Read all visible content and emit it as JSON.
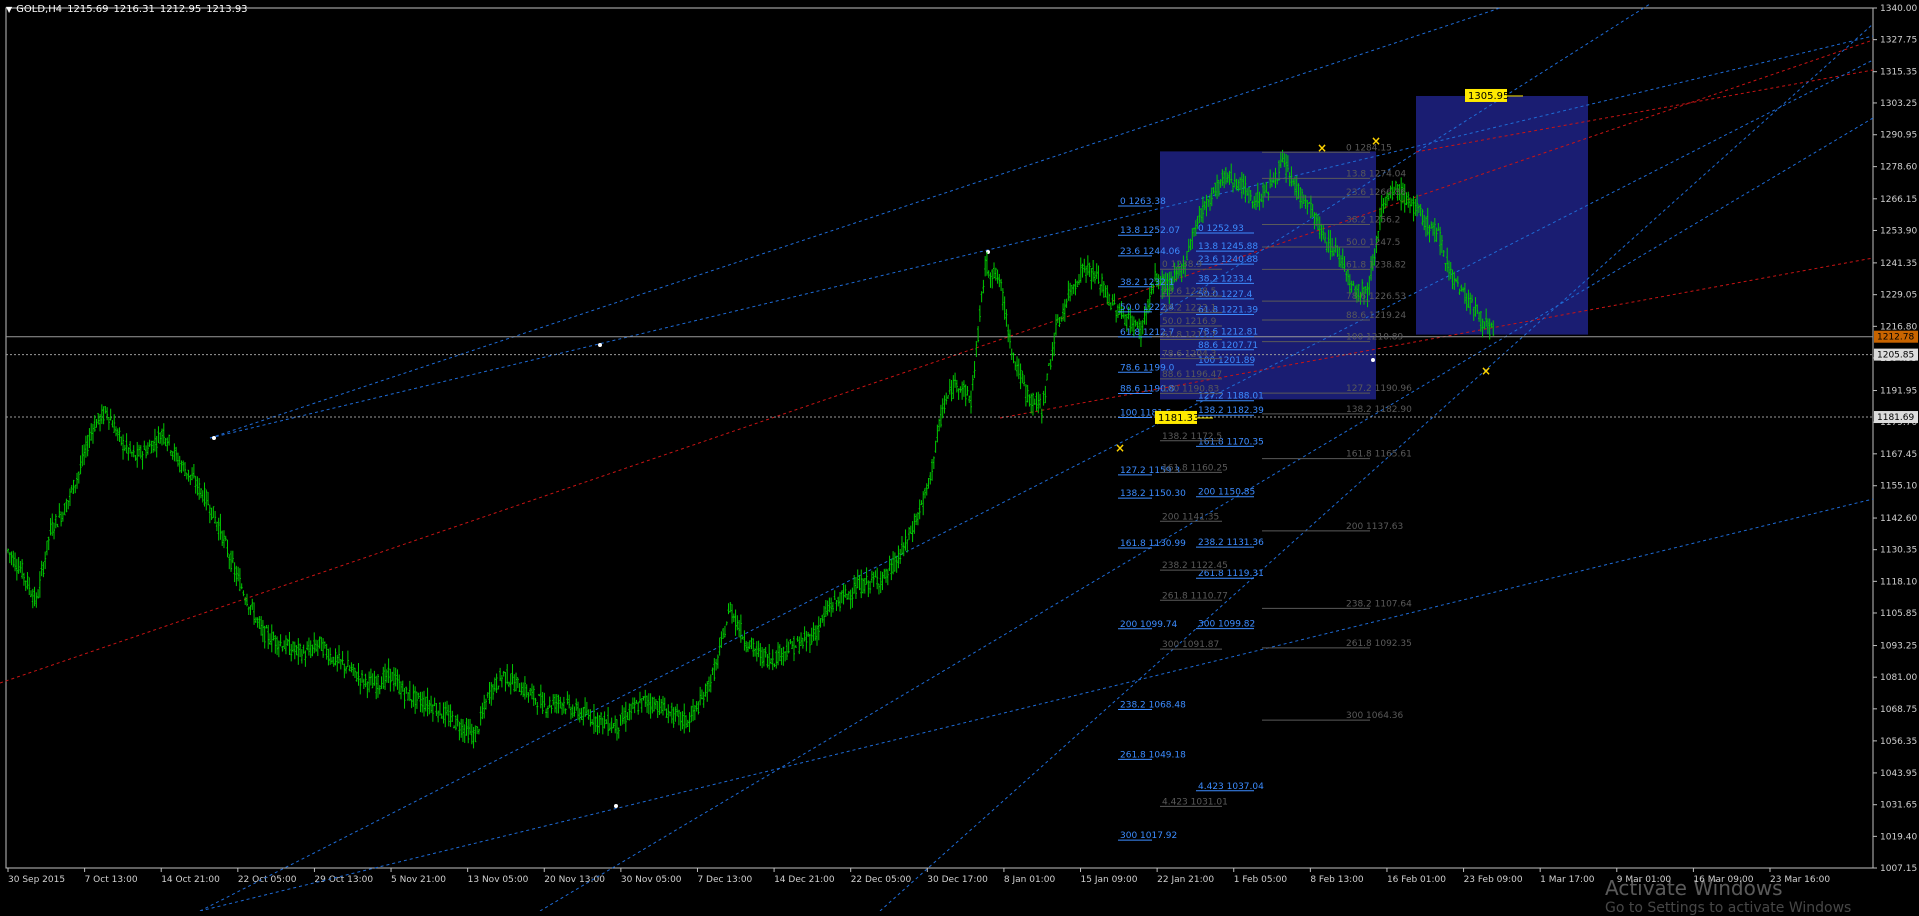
{
  "header": {
    "symbol": "GOLD,H4",
    "open": "1215.69",
    "high": "1216.31",
    "low": "1212.95",
    "close": "1213.93"
  },
  "watermark": {
    "line1": "Activate Windows",
    "line2": "Go to Settings to activate Windows"
  },
  "colors": {
    "background": "#000000",
    "candles": "#00c800",
    "axis": "#ffffff",
    "blue_line": "#1e6bd6",
    "red_line": "#c81414",
    "box": "#1b1f78",
    "fib_blue": "#3c8cff",
    "fib_grey": "#5a5a5a",
    "marker": "#ffd400"
  },
  "chart_data": {
    "type": "candlestick",
    "title": "GOLD,H4",
    "ylim": [
      1007.15,
      1340.0
    ],
    "y_ticks": [
      "1340.00",
      "1327.75",
      "1315.35",
      "1303.25",
      "1290.95",
      "1278.60",
      "1266.15",
      "1253.90",
      "1241.35",
      "1229.05",
      "1216.80",
      "1204.55",
      "1191.95",
      "1179.70",
      "1167.45",
      "1155.10",
      "1142.60",
      "1130.35",
      "1118.10",
      "1105.85",
      "1093.25",
      "1081.00",
      "1068.75",
      "1056.35",
      "1043.95",
      "1031.65",
      "1019.40",
      "1007.15"
    ],
    "x_ticks": [
      "30 Sep 2015",
      "7 Oct 13:00",
      "14 Oct 21:00",
      "22 Oct 05:00",
      "29 Oct 13:00",
      "5 Nov 21:00",
      "13 Nov 05:00",
      "20 Nov 13:00",
      "30 Nov 05:00",
      "7 Dec 13:00",
      "14 Dec 21:00",
      "22 Dec 05:00",
      "30 Dec 17:00",
      "8 Jan 01:00",
      "15 Jan 09:00",
      "22 Jan 21:00",
      "1 Feb 05:00",
      "8 Feb 13:00",
      "16 Feb 01:00",
      "23 Feb 09:00",
      "1 Mar 17:00",
      "9 Mar 01:00",
      "16 Mar 09:00",
      "23 Mar 16:00"
    ],
    "price_path": [
      1130,
      1122,
      1110,
      1138,
      1146,
      1160,
      1178,
      1184,
      1172,
      1166,
      1170,
      1176,
      1165,
      1158,
      1150,
      1138,
      1122,
      1110,
      1098,
      1095,
      1092,
      1090,
      1094,
      1088,
      1085,
      1080,
      1078,
      1082,
      1075,
      1072,
      1070,
      1066,
      1062,
      1058,
      1075,
      1082,
      1078,
      1074,
      1070,
      1072,
      1068,
      1066,
      1064,
      1062,
      1068,
      1072,
      1070,
      1066,
      1064,
      1072,
      1085,
      1108,
      1096,
      1090,
      1088,
      1092,
      1094,
      1098,
      1108,
      1112,
      1116,
      1118,
      1120,
      1128,
      1140,
      1155,
      1185,
      1196,
      1188,
      1240,
      1235,
      1205,
      1190,
      1185,
      1215,
      1230,
      1240,
      1235,
      1225,
      1220,
      1215,
      1235,
      1232,
      1240,
      1258,
      1268,
      1275,
      1272,
      1265,
      1270,
      1280,
      1270,
      1262,
      1250,
      1245,
      1232,
      1230,
      1262,
      1270,
      1265,
      1258,
      1252,
      1236,
      1228,
      1220,
      1213
    ],
    "horizontal_levels": [
      {
        "price": "1212.78",
        "label_color": "#c86400"
      },
      {
        "price": "1205.85",
        "label_color": "#c8c8c8"
      },
      {
        "price": "1181.69",
        "label_color": "#c8c8c8"
      }
    ],
    "price_labels": [
      {
        "text": "1305.95",
        "price": 1305.95
      },
      {
        "text": "1181.33",
        "price": 1181.33
      }
    ],
    "fib_left_blue": [
      {
        "text": "0 1263.38",
        "price": 1263.38
      },
      {
        "text": "13.8 1252.07",
        "price": 1252.07
      },
      {
        "text": "23.6 1244.06",
        "price": 1244.06
      },
      {
        "text": "38.2 1232.1",
        "price": 1232.1
      },
      {
        "text": "50.0 1222.4",
        "price": 1222.4
      },
      {
        "text": "61.8 1212.7",
        "price": 1212.7
      },
      {
        "text": "78.6 1199.0",
        "price": 1199.0
      },
      {
        "text": "88.6 1190.8",
        "price": 1190.8
      },
      {
        "text": "100 1181.5",
        "price": 1181.5
      },
      {
        "text": "127.2 1159.3",
        "price": 1159.3
      },
      {
        "text": "138.2 1150.30",
        "price": 1150.3
      },
      {
        "text": "161.8 1130.99",
        "price": 1130.99
      },
      {
        "text": "200 1099.74",
        "price": 1099.74
      },
      {
        "text": "238.2 1068.48",
        "price": 1068.48
      },
      {
        "text": "261.8 1049.18",
        "price": 1049.18
      },
      {
        "text": "300 1017.92",
        "price": 1017.92
      }
    ],
    "fib_mid_blue": [
      {
        "text": "0 1252.93",
        "price": 1252.93
      },
      {
        "text": "13.8 1245.88",
        "price": 1245.88
      },
      {
        "text": "23.6 1240.88",
        "price": 1240.88
      },
      {
        "text": "38.2 1233.4",
        "price": 1233.4
      },
      {
        "text": "50.0 1227.4",
        "price": 1227.4
      },
      {
        "text": "61.8 1221.39",
        "price": 1221.39
      },
      {
        "text": "78.6 1212.81",
        "price": 1212.81
      },
      {
        "text": "88.6 1207.71",
        "price": 1207.71
      },
      {
        "text": "100 1201.89",
        "price": 1201.89
      },
      {
        "text": "127.2 1188.01",
        "price": 1188.01
      },
      {
        "text": "138.2 1182.39",
        "price": 1182.39
      },
      {
        "text": "161.8 1170.35",
        "price": 1170.35
      },
      {
        "text": "200 1150.85",
        "price": 1150.85
      },
      {
        "text": "238.2 1131.36",
        "price": 1131.36
      },
      {
        "text": "261.8 1119.31",
        "price": 1119.31
      },
      {
        "text": "300 1099.82",
        "price": 1099.82
      },
      {
        "text": "4.423 1037.04",
        "price": 1037.04
      }
    ],
    "fib_mid_grey": [
      {
        "text": "0 1238.9",
        "price": 1238.9
      },
      {
        "text": "23.6 1228.5",
        "price": 1228.5
      },
      {
        "text": "38.2 1222.1",
        "price": 1222.1
      },
      {
        "text": "50.0 1216.9",
        "price": 1216.9
      },
      {
        "text": "61.8 1211.7",
        "price": 1211.7
      },
      {
        "text": "78.6 1204.3",
        "price": 1204.3
      },
      {
        "text": "88.6 1196.47",
        "price": 1196.47
      },
      {
        "text": "100 1190.83",
        "price": 1190.83
      },
      {
        "text": "138.2 1172.5",
        "price": 1172.5
      },
      {
        "text": "161.8 1160.25",
        "price": 1160.25
      },
      {
        "text": "200 1141.35",
        "price": 1141.35
      },
      {
        "text": "238.2 1122.45",
        "price": 1122.45
      },
      {
        "text": "261.8 1110.77",
        "price": 1110.77
      },
      {
        "text": "300 1091.87",
        "price": 1091.87
      },
      {
        "text": "4.423 1031.01",
        "price": 1031.01
      }
    ],
    "fib_right_grey": [
      {
        "text": "0 1284.15",
        "price": 1284.15
      },
      {
        "text": "13.8 1274.04",
        "price": 1274.04
      },
      {
        "text": "23.6 1266.86",
        "price": 1266.86
      },
      {
        "text": "38.2 1256.2",
        "price": 1256.2
      },
      {
        "text": "50.0 1247.5",
        "price": 1247.5
      },
      {
        "text": "61.8 1238.82",
        "price": 1238.82
      },
      {
        "text": "78.6 1226.53",
        "price": 1226.53
      },
      {
        "text": "88.6 1219.24",
        "price": 1219.24
      },
      {
        "text": "100 1210.89",
        "price": 1210.89
      },
      {
        "text": "127.2 1190.96",
        "price": 1190.96
      },
      {
        "text": "138.2 1182.90",
        "price": 1182.9
      },
      {
        "text": "161.8 1165.61",
        "price": 1165.61
      },
      {
        "text": "200 1137.63",
        "price": 1137.63
      },
      {
        "text": "238.2 1107.64",
        "price": 1107.64
      },
      {
        "text": "261.8 1092.35",
        "price": 1092.35
      },
      {
        "text": "300 1064.36",
        "price": 1064.36
      }
    ]
  }
}
